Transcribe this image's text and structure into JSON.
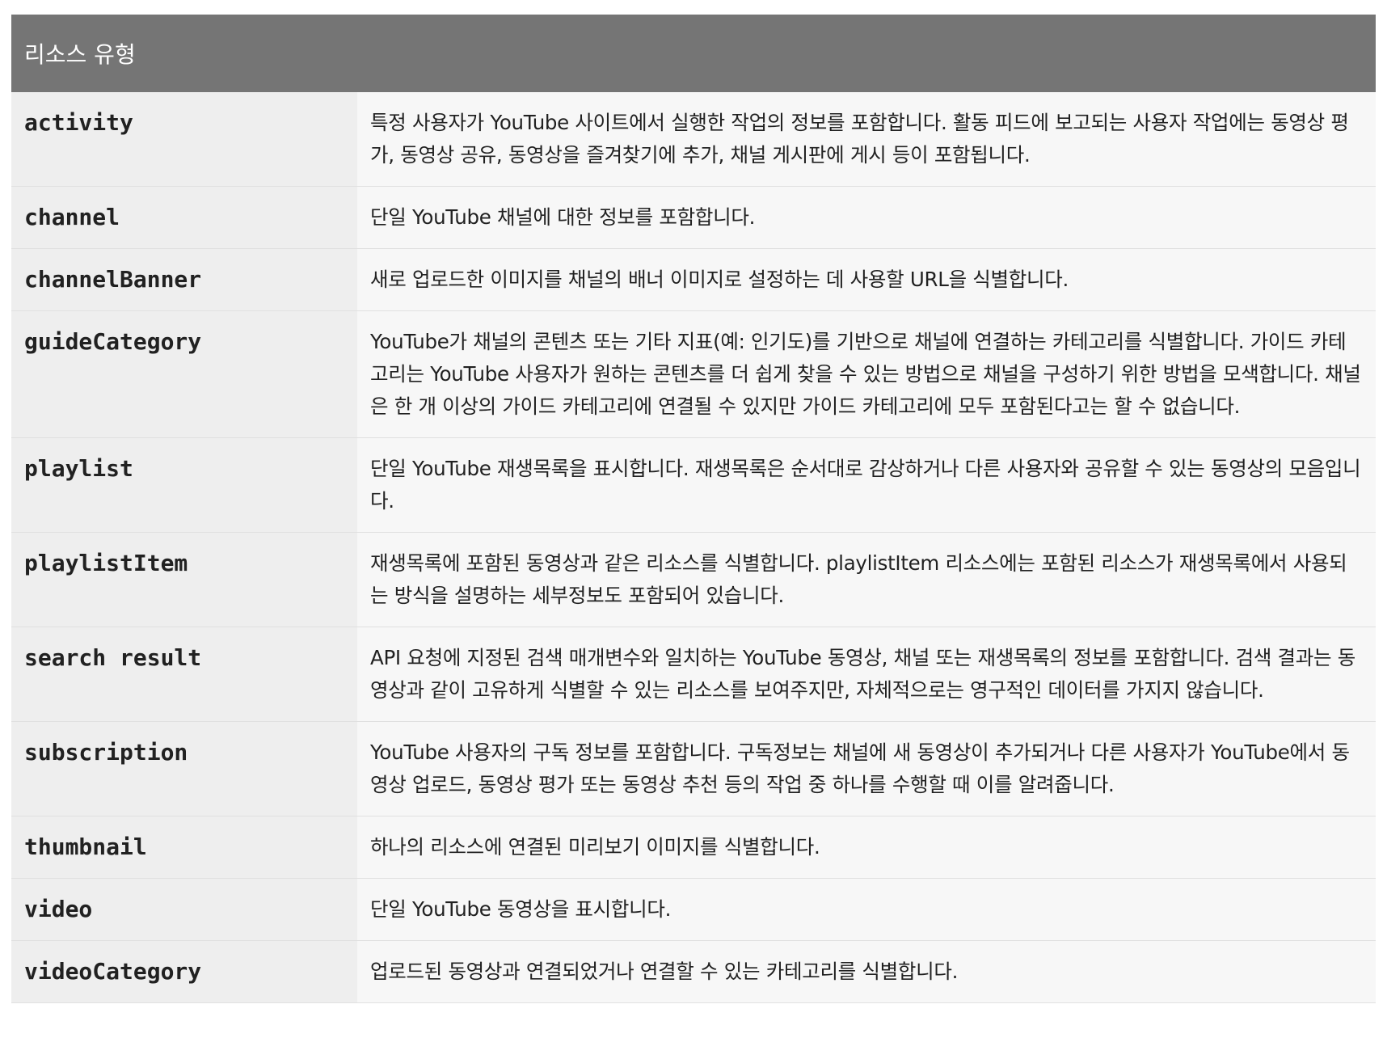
{
  "table": {
    "header": "리소스 유형",
    "rows": [
      {
        "name": "activity",
        "description": "특정 사용자가 YouTube 사이트에서 실행한 작업의 정보를 포함합니다. 활동 피드에 보고되는 사용자 작업에는 동영상 평가, 동영상 공유, 동영상을 즐겨찾기에 추가, 채널 게시판에 게시 등이 포함됩니다."
      },
      {
        "name": "channel",
        "description": "단일 YouTube 채널에 대한 정보를 포함합니다."
      },
      {
        "name": "channelBanner",
        "description": "새로 업로드한 이미지를 채널의 배너 이미지로 설정하는 데 사용할 URL을 식별합니다."
      },
      {
        "name": "guideCategory",
        "description": "YouTube가 채널의 콘텐츠 또는 기타 지표(예: 인기도)를 기반으로 채널에 연결하는 카테고리를 식별합니다. 가이드 카테고리는 YouTube 사용자가 원하는 콘텐츠를 더 쉽게 찾을 수 있는 방법으로 채널을 구성하기 위한 방법을 모색합니다. 채널은 한 개 이상의 가이드 카테고리에 연결될 수 있지만 가이드 카테고리에 모두 포함된다고는 할 수 없습니다."
      },
      {
        "name": "playlist",
        "description": "단일 YouTube 재생목록을 표시합니다. 재생목록은 순서대로 감상하거나 다른 사용자와 공유할 수 있는 동영상의 모음입니다."
      },
      {
        "name": "playlistItem",
        "description": "재생목록에 포함된 동영상과 같은 리소스를 식별합니다. playlistItem 리소스에는 포함된 리소스가 재생목록에서 사용되는 방식을 설명하는 세부정보도 포함되어 있습니다."
      },
      {
        "name": "search result",
        "description": "API 요청에 지정된 검색 매개변수와 일치하는 YouTube 동영상, 채널 또는 재생목록의 정보를 포함합니다. 검색 결과는 동영상과 같이 고유하게 식별할 수 있는 리소스를 보여주지만, 자체적으로는 영구적인 데이터를 가지지 않습니다."
      },
      {
        "name": "subscription",
        "description": "YouTube 사용자의 구독 정보를 포함합니다. 구독정보는 채널에 새 동영상이 추가되거나 다른 사용자가 YouTube에서 동영상 업로드, 동영상 평가 또는 동영상 추천 등의 작업 중 하나를 수행할 때 이를 알려줍니다."
      },
      {
        "name": "thumbnail",
        "description": "하나의 리소스에 연결된 미리보기 이미지를 식별합니다."
      },
      {
        "name": "video",
        "description": "단일 YouTube 동영상을 표시합니다."
      },
      {
        "name": "videoCategory",
        "description": "업로드된 동영상과 연결되었거나 연결할 수 있는 카테고리를 식별합니다."
      }
    ]
  }
}
